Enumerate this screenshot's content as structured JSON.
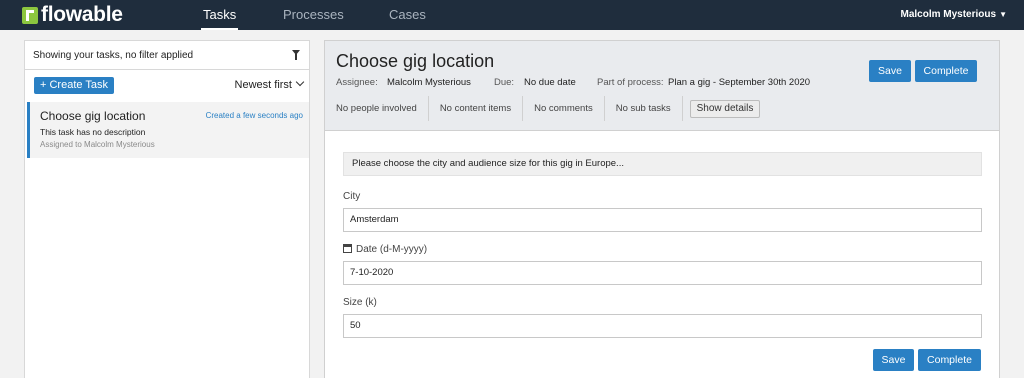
{
  "nav": {
    "logo_text": "flowable",
    "tabs": [
      {
        "label": "Tasks",
        "active": true
      },
      {
        "label": "Processes",
        "active": false
      },
      {
        "label": "Cases",
        "active": false
      }
    ],
    "user": "Malcolm Mysterious"
  },
  "task_list": {
    "filter_text": "Showing your tasks, no filter applied",
    "create_label": "+ Create Task",
    "sort_label": "Newest first",
    "items": [
      {
        "name": "Choose gig location",
        "created": "Created a few seconds ago",
        "description": "This task has no description",
        "assigned": "Assigned to Malcolm Mysterious"
      }
    ]
  },
  "task_detail": {
    "title": "Choose gig location",
    "assignee_label": "Assignee:",
    "assignee": "Malcolm Mysterious",
    "due_label": "Due:",
    "due": "No due date",
    "process_label": "Part of process:",
    "process": "Plan a gig - September 30th 2020",
    "save_label": "Save",
    "complete_label": "Complete",
    "chips": [
      "No people involved",
      "No content items",
      "No comments",
      "No sub tasks"
    ],
    "show_details_label": "Show details"
  },
  "form": {
    "instruction": "Please choose the city and audience size for this gig in Europe...",
    "city_label": "City",
    "city_value": "Amsterdam",
    "date_label": "Date",
    "date_format": "(d-M-yyyy)",
    "date_value": "7-10-2020",
    "size_label": "Size (k)",
    "size_value": "50",
    "save_label": "Save",
    "complete_label": "Complete"
  },
  "colors": {
    "navbar": "#1f2d3d",
    "primary": "#2a80c4",
    "logo_green": "#8cc63f"
  }
}
